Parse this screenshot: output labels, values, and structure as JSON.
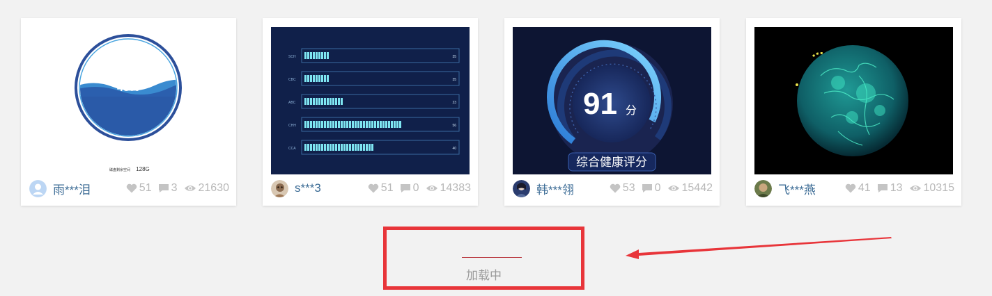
{
  "cards": [
    {
      "author": "雨***泪",
      "likes": "51",
      "comments": "3",
      "views": "21630",
      "preview": {
        "percent": "48%",
        "caption": "磁盘剩余空间",
        "value": "128G"
      }
    },
    {
      "author": "s***3",
      "likes": "51",
      "comments": "0",
      "views": "14383",
      "preview": {
        "rows": [
          {
            "label": "SCH",
            "value": "35"
          },
          {
            "label": "CBC",
            "value": "35"
          },
          {
            "label": "ABC",
            "value": "23"
          },
          {
            "label": "CHH",
            "value": "56"
          },
          {
            "label": "CCA",
            "value": "40"
          }
        ]
      }
    },
    {
      "author": "韩***翎",
      "likes": "53",
      "comments": "0",
      "views": "15442",
      "preview": {
        "score": "91",
        "unit": "分",
        "label": "综合健康评分"
      }
    },
    {
      "author": "飞***燕",
      "likes": "41",
      "comments": "13",
      "views": "10315",
      "preview": {}
    }
  ],
  "loading": {
    "text": "加载中"
  },
  "colors": {
    "accent": "#e8353a",
    "author": "#3b6b95",
    "stat": "#b8b8b8"
  }
}
